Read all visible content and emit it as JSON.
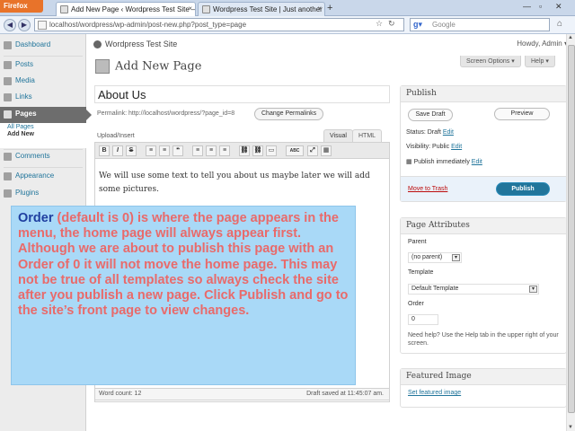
{
  "browser": {
    "app_button": "Firefox",
    "tabs": [
      {
        "label": "Add New Page ‹ Wordpress Test Site —",
        "active": true
      },
      {
        "label": "Wordpress Test Site | Just another Wo...",
        "active": false
      }
    ],
    "new_tab": "+",
    "url": "localhost/wordpress/wp-admin/post-new.php?post_type=page",
    "search_engine": "Google",
    "search_placeholder": "Google"
  },
  "sidebar": {
    "items": [
      {
        "label": "Dashboard",
        "icon": "dashboard-icon"
      },
      {
        "label": "Posts",
        "icon": "pin-icon"
      },
      {
        "label": "Media",
        "icon": "media-icon"
      },
      {
        "label": "Links",
        "icon": "link-icon"
      },
      {
        "label": "Pages",
        "icon": "page-icon",
        "active": true
      },
      {
        "label": "Comments",
        "icon": "comment-icon"
      },
      {
        "label": "Appearance",
        "icon": "appearance-icon"
      },
      {
        "label": "Plugins",
        "icon": "plugin-icon"
      }
    ],
    "submenu": [
      "All Pages",
      "Add New"
    ]
  },
  "header": {
    "site_title": "Wordpress Test Site",
    "howdy": "Howdy, Admin ▾",
    "screen_options": "Screen Options ▾",
    "help": "Help ▾",
    "page_title": "Add New Page"
  },
  "editor": {
    "title_value": "About Us",
    "permalink": "Permalink: http://localhost/wordpress/?page_id=8",
    "change_permalinks": "Change Permalinks",
    "upload_insert": "Upload/Insert",
    "tab_visual": "Visual",
    "tab_html": "HTML",
    "toolbar": [
      "B",
      "I",
      "S",
      "≡",
      "≡",
      "❝",
      "≡",
      "≡",
      "≡",
      "⛓",
      "⛓",
      "▭",
      "ABC",
      "⤢",
      "▦"
    ],
    "content": "We will use some text to tell you about us maybe later we will add some pictures.",
    "word_count": "Word count: 12",
    "draft_saved": "Draft saved at 11:45:07 am."
  },
  "publish": {
    "heading": "Publish",
    "save_draft": "Save Draft",
    "preview": "Preview",
    "status_label": "Status: Draft",
    "status_edit": "Edit",
    "visibility_label": "Visibility: Public",
    "visibility_edit": "Edit",
    "publish_label": "Publish immediately",
    "publish_edit": "Edit",
    "trash": "Move to Trash",
    "publish_button": "Publish"
  },
  "attributes": {
    "heading": "Page Attributes",
    "parent_label": "Parent",
    "parent_value": "(no parent)",
    "template_label": "Template",
    "template_value": "Default Template",
    "order_label": "Order",
    "order_value": "0",
    "help_text": "Need help? Use the Help tab in the upper right of your screen."
  },
  "featured": {
    "heading": "Featured Image",
    "link": "Set featured image"
  },
  "overlay": {
    "keyword": "Order",
    "text": " (default is 0) is where the page appears in the menu, the home page will always appear first. Although we are about to publish this page with an Order of 0 it will not move the home page. This may not be true of all templates so always check the site after you publish a new page. Click Publish and go to the site’s front page to view changes."
  },
  "colors": {
    "wp_link": "#21759b",
    "publish_button": "#21759b",
    "overlay_bg": "#a9d9f7",
    "overlay_keyword": "#1f3fa0",
    "overlay_text": "#e96a6a",
    "trash": "#bc0b0b"
  }
}
